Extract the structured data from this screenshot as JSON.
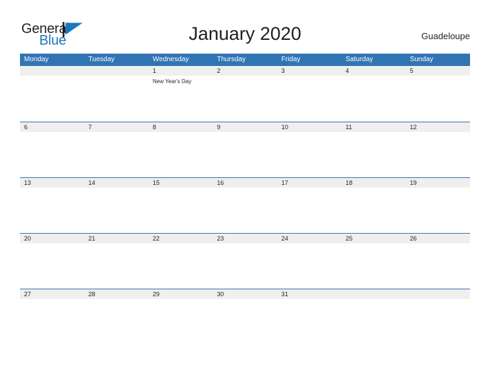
{
  "brand": {
    "name_part1": "General",
    "name_part2": "Blue",
    "flag_icon": "flag-triangle-icon",
    "color_dark": "#231f20",
    "color_blue": "#1878be"
  },
  "header": {
    "title": "January 2020",
    "location": "Guadeloupe"
  },
  "theme": {
    "header_blue": "#3174b4",
    "strip_gray": "#efefef",
    "text_dark": "#231f20",
    "white": "#ffffff"
  },
  "calendar": {
    "weekday_headers": [
      "Monday",
      "Tuesday",
      "Wednesday",
      "Thursday",
      "Friday",
      "Saturday",
      "Sunday"
    ],
    "weeks": [
      [
        {
          "num": "",
          "events": []
        },
        {
          "num": "",
          "events": []
        },
        {
          "num": "1",
          "events": [
            "New Year's Day"
          ]
        },
        {
          "num": "2",
          "events": []
        },
        {
          "num": "3",
          "events": []
        },
        {
          "num": "4",
          "events": []
        },
        {
          "num": "5",
          "events": []
        }
      ],
      [
        {
          "num": "6",
          "events": []
        },
        {
          "num": "7",
          "events": []
        },
        {
          "num": "8",
          "events": []
        },
        {
          "num": "9",
          "events": []
        },
        {
          "num": "10",
          "events": []
        },
        {
          "num": "11",
          "events": []
        },
        {
          "num": "12",
          "events": []
        }
      ],
      [
        {
          "num": "13",
          "events": []
        },
        {
          "num": "14",
          "events": []
        },
        {
          "num": "15",
          "events": []
        },
        {
          "num": "16",
          "events": []
        },
        {
          "num": "17",
          "events": []
        },
        {
          "num": "18",
          "events": []
        },
        {
          "num": "19",
          "events": []
        }
      ],
      [
        {
          "num": "20",
          "events": []
        },
        {
          "num": "21",
          "events": []
        },
        {
          "num": "22",
          "events": []
        },
        {
          "num": "23",
          "events": []
        },
        {
          "num": "24",
          "events": []
        },
        {
          "num": "25",
          "events": []
        },
        {
          "num": "26",
          "events": []
        }
      ],
      [
        {
          "num": "27",
          "events": []
        },
        {
          "num": "28",
          "events": []
        },
        {
          "num": "29",
          "events": []
        },
        {
          "num": "30",
          "events": []
        },
        {
          "num": "31",
          "events": []
        },
        {
          "num": "",
          "events": []
        },
        {
          "num": "",
          "events": []
        }
      ]
    ]
  }
}
